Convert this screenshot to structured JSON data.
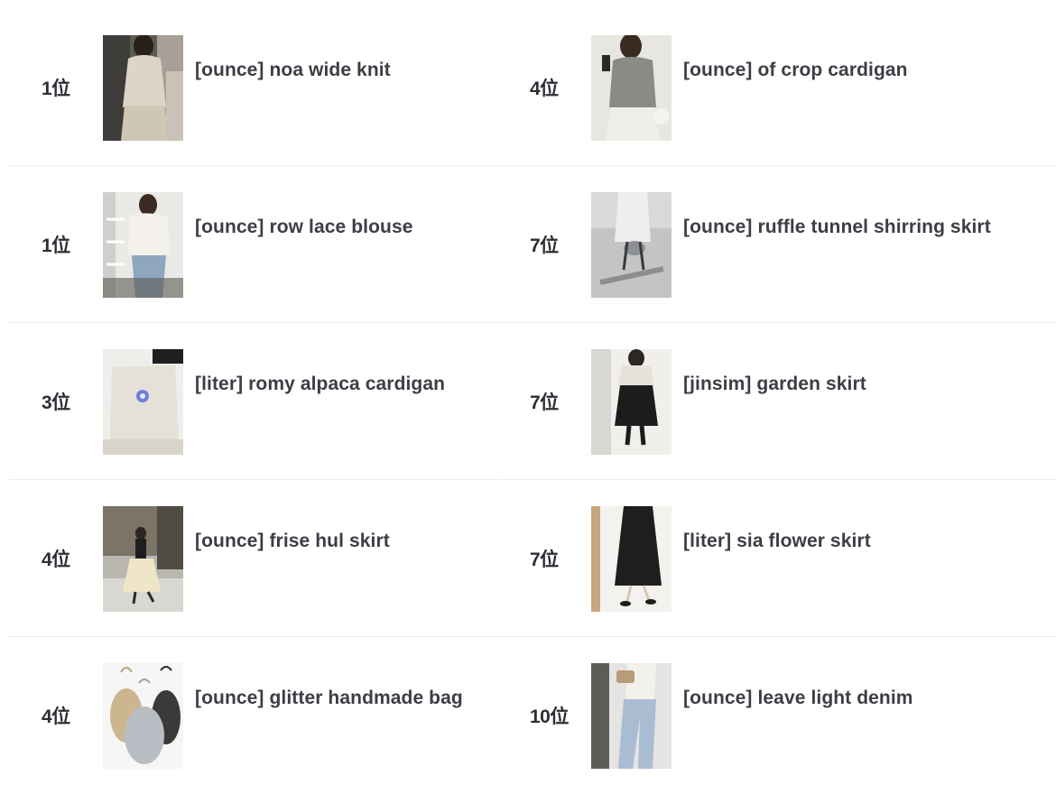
{
  "left": [
    {
      "rank": "1位",
      "title": "[ounce] noa wide knit",
      "thumb_icon": "model-knit-photo"
    },
    {
      "rank": "1位",
      "title": "[ounce] row lace blouse",
      "thumb_icon": "model-blouse-photo"
    },
    {
      "rank": "3位",
      "title": "[liter] romy alpaca cardigan",
      "thumb_icon": "cardigan-flatlay-photo"
    },
    {
      "rank": "4位",
      "title": "[ounce] frise hul skirt",
      "thumb_icon": "street-skirt-photo"
    },
    {
      "rank": "4位",
      "title": "[ounce] glitter handmade bag",
      "thumb_icon": "knit-bags-photo"
    }
  ],
  "right": [
    {
      "rank": "4位",
      "title": "[ounce] of crop cardigan",
      "thumb_icon": "mirror-selfie-photo"
    },
    {
      "rank": "7位",
      "title": "[ounce] ruffle tunnel shirring skirt",
      "thumb_icon": "ruffle-skirt-photo"
    },
    {
      "rank": "7位",
      "title": "[jinsim] garden skirt",
      "thumb_icon": "black-skirt-photo"
    },
    {
      "rank": "7位",
      "title": "[liter] sia flower skirt",
      "thumb_icon": "flower-skirt-photo"
    },
    {
      "rank": "10位",
      "title": "[ounce] leave light denim",
      "thumb_icon": "denim-photo"
    }
  ]
}
